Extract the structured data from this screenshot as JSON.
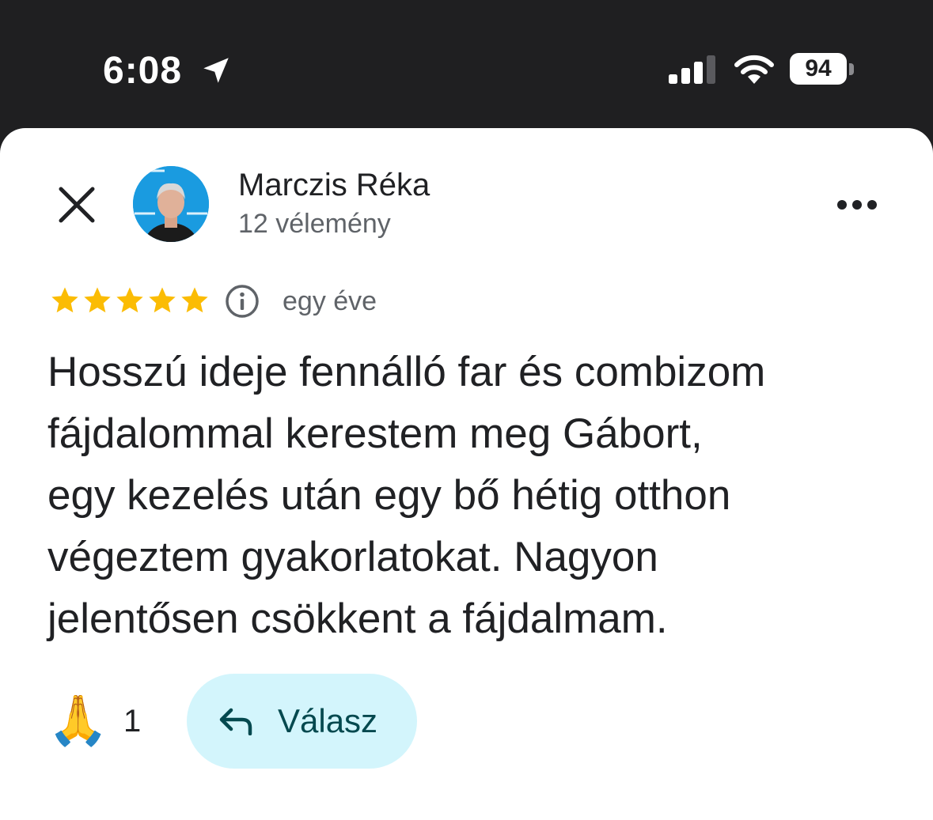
{
  "status_bar": {
    "time": "6:08",
    "battery": "94",
    "location_icon": "location-arrow-icon",
    "signal_icon": "cellular-signal-icon",
    "wifi_icon": "wifi-icon"
  },
  "review": {
    "author": {
      "name": "Marczis Réka",
      "review_count": "12 vélemény",
      "avatar_icon": "profile-photo"
    },
    "rating": 5,
    "max_rating": 5,
    "time": "egy éve",
    "text": "Hosszú ideje fennálló far és combizom\nfájdalommal kerestem meg Gábort,\negy kezelés után egy bő hétig otthon\nvégeztem gyakorlatokat. Nagyon\njelentősen csökkent a fájdalmam.",
    "reaction": {
      "emoji": "🙏",
      "count": "1"
    },
    "reply_label": "Válasz"
  },
  "colors": {
    "status_bar_bg": "#1f1f21",
    "star": "#fbbc04",
    "reply_bg": "#d3f5fc",
    "reply_text": "#04494f",
    "primary_text": "#202124",
    "secondary_text": "#5f6368"
  }
}
